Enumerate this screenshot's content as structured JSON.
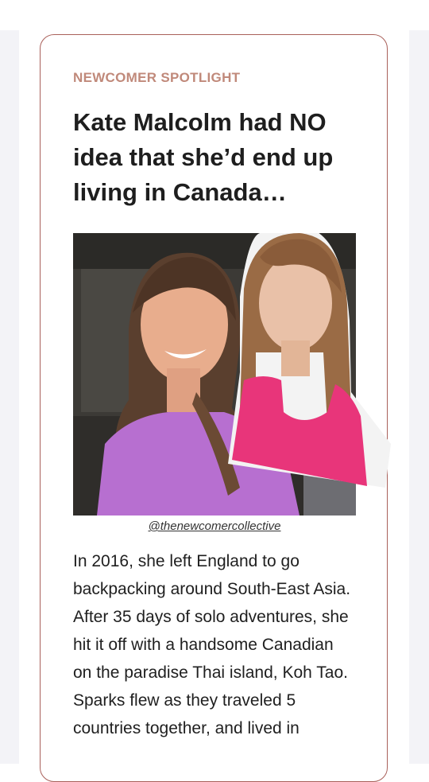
{
  "article": {
    "category": "NEWCOMER SPOTLIGHT",
    "headline": "Kate Malcolm had NO idea that she’d end up living in Canada…",
    "photo_credit": "@thenewcomercollective",
    "body": "In 2016, she left England to go backpacking around South-East Asia. After 35 days of solo adventures, she hit it off with a handsome Canadian on the paradise Thai island, Koh Tao. Sparks flew as they traveled 5 countries together, and lived in"
  },
  "colors": {
    "card_border": "#a9605a",
    "category": "#c0897a",
    "headline": "#1e1e1e",
    "body": "#1f1f1f"
  }
}
